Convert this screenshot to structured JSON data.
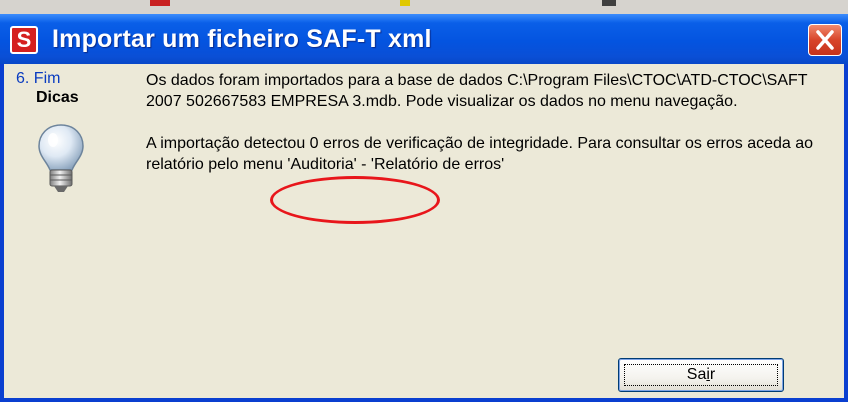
{
  "dialog": {
    "title": "Importar um ficheiro SAF-T xml",
    "app_icon_letter": "S",
    "close_icon": "close-icon"
  },
  "sidebar": {
    "step": "6. Fim",
    "hints_label": "Dicas",
    "icon": "lightbulb-icon"
  },
  "message": {
    "paragraph1": "Os dados foram importados para a base de dados C:\\Program Files\\CTOC\\ATD-CTOC\\SAFT 2007 502667583 EMPRESA 3.mdb. Pode visualizar os dados no menu navegação.",
    "paragraph2": "A importação detectou 0 erros de verificação de integridade. Para consultar os erros aceda ao relatório pelo menu 'Auditoria' - 'Relatório de erros'"
  },
  "buttons": {
    "exit_prefix": "Sa",
    "exit_access_key": "i",
    "exit_suffix": "r"
  },
  "colors": {
    "titlebar": "#0454e0",
    "dialog_face": "#ece9d8",
    "close_button": "#d8452a",
    "annotation_ring": "#e8161b"
  }
}
